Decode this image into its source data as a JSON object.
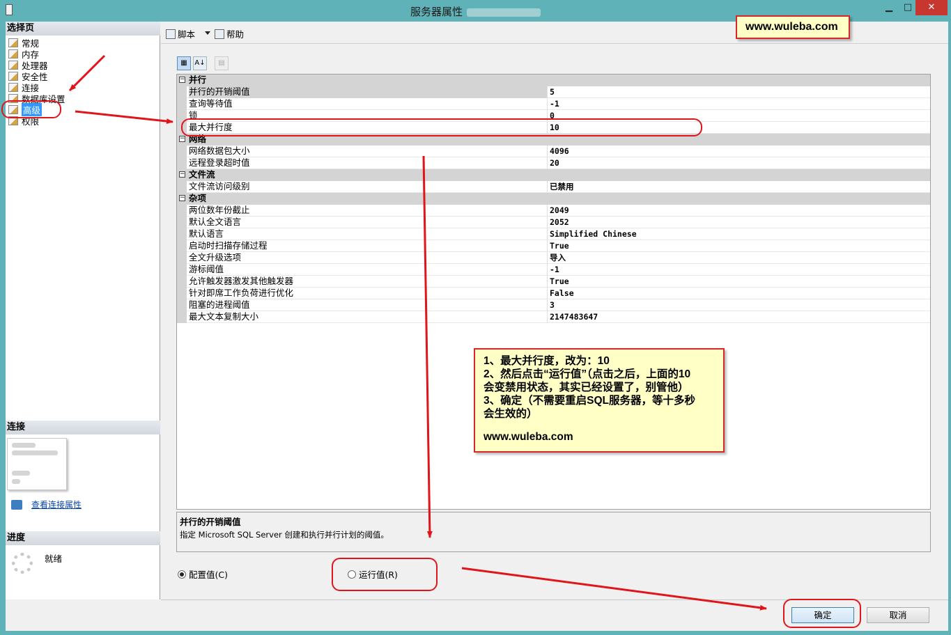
{
  "window": {
    "title": "服务器属性",
    "title_suffix_redacted": "",
    "min_glyph": "▁",
    "max_glyph": "□",
    "close_glyph": "✕"
  },
  "left": {
    "select_page_header": "选择页",
    "pages": [
      {
        "label": "常规"
      },
      {
        "label": "内存"
      },
      {
        "label": "处理器"
      },
      {
        "label": "安全性"
      },
      {
        "label": "连接"
      },
      {
        "label": "数据库设置"
      },
      {
        "label": "高级",
        "selected": true
      },
      {
        "label": "权限"
      }
    ],
    "connection_header": "连接",
    "view_connection_link": "查看连接属性",
    "progress_header": "进度",
    "progress_status": "就绪"
  },
  "toolbar": {
    "script_label": "脚本",
    "help_label": "帮助"
  },
  "prop_toolbar": {
    "categorized": "▦",
    "alphabetical": "A↓",
    "property_pages": "▤"
  },
  "grid": {
    "categories": [
      {
        "name": "并行",
        "properties": [
          {
            "name": "并行的开销阈值",
            "value": "5",
            "selected": true
          },
          {
            "name": "查询等待值",
            "value": "-1"
          },
          {
            "name": "锁",
            "value": "0"
          },
          {
            "name": "最大并行度",
            "value": "10"
          }
        ]
      },
      {
        "name": "网络",
        "properties": [
          {
            "name": "网络数据包大小",
            "value": "4096"
          },
          {
            "name": "远程登录超时值",
            "value": "20"
          }
        ]
      },
      {
        "name": "文件流",
        "properties": [
          {
            "name": "文件流访问级别",
            "value": "已禁用",
            "cjk": true
          }
        ]
      },
      {
        "name": "杂项",
        "properties": [
          {
            "name": "两位数年份截止",
            "value": "2049"
          },
          {
            "name": "默认全文语言",
            "value": "2052"
          },
          {
            "name": "默认语言",
            "value": "Simplified Chinese"
          },
          {
            "name": "启动时扫描存储过程",
            "value": "True"
          },
          {
            "name": "全文升级选项",
            "value": "导入",
            "cjk": true
          },
          {
            "name": "游标阈值",
            "value": "-1"
          },
          {
            "name": "允许触发器激发其他触发器",
            "value": "True"
          },
          {
            "name": "针对即席工作负荷进行优化",
            "value": "False"
          },
          {
            "name": "阻塞的进程阈值",
            "value": "3"
          },
          {
            "name": "最大文本复制大小",
            "value": "2147483647"
          }
        ]
      }
    ]
  },
  "description": {
    "title": "并行的开销阈值",
    "text": "指定 Microsoft SQL Server 创建和执行并行计划的阈值。"
  },
  "radios": {
    "configured": "配置值(C)",
    "running": "运行值(R)"
  },
  "buttons": {
    "ok": "确定",
    "cancel": "取消"
  },
  "annotations": {
    "watermark": "www.wuleba.com",
    "note_lines": [
      "1、最大并行度，改为：10",
      "2、然后点击“运行值”（点击之后，上面的10",
      "会变禁用状态，其实已经设置了，别管他）",
      "3、确定（不需要重启SQL服务器，等十多秒",
      "会生效的）"
    ],
    "note_url": "www.wuleba.com",
    "annotation_color": "#e0151b"
  },
  "colors": {
    "window_frame": "#5fb2b7",
    "selection": "#3399ff",
    "note_bg": "#ffffc6"
  }
}
